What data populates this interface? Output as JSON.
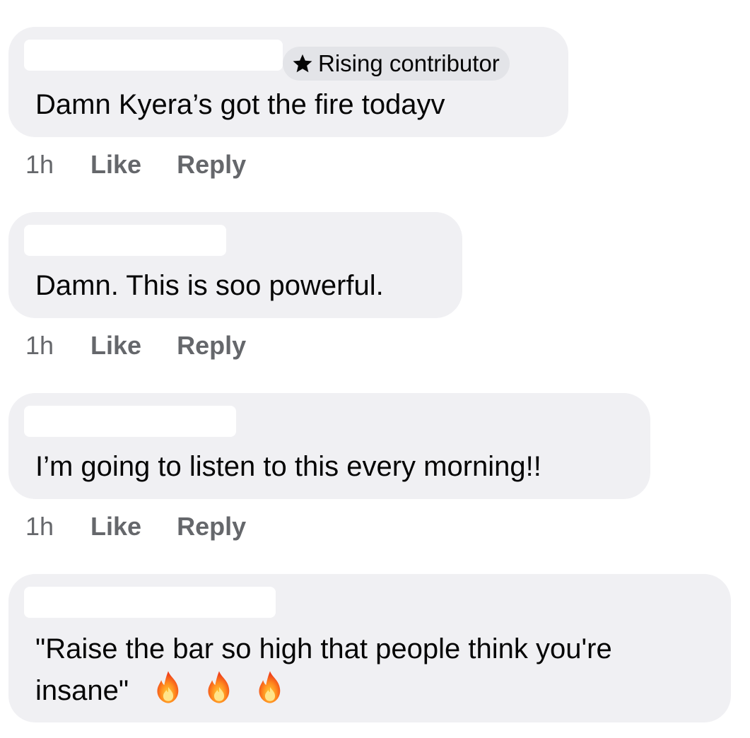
{
  "comments": [
    {
      "badge": "Rising contributor",
      "badge_icon": "star-icon",
      "text": "Damn Kyera’s got the fire todayv",
      "time": "1h",
      "like": "Like",
      "reply": "Reply"
    },
    {
      "text": "Damn. This is soo powerful.",
      "time": "1h",
      "like": "Like",
      "reply": "Reply"
    },
    {
      "text": "I’m going to listen to this every morning!!",
      "time": "1h",
      "like": "Like",
      "reply": "Reply"
    },
    {
      "text_line1": "\"Raise the bar so high that people think you're",
      "text_line2": "insane\"",
      "emoji_icon": "fire-emoji-icon"
    }
  ],
  "colors": {
    "bubble": "#f0f0f3",
    "badge": "#e3e4e8",
    "meta_text": "#65676b",
    "body_text": "#050505"
  }
}
